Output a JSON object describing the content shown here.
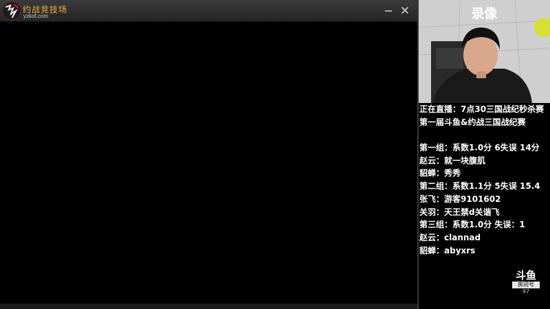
{
  "window": {
    "title": "约战竞技场",
    "domain": "yzkof.com",
    "minimize_symbol": "—",
    "close_symbol": "✕"
  },
  "camera": {
    "label": "录像"
  },
  "overlay_lines": [
    "正在直播：7点30三国战纪秒杀赛",
    "第一届斗鱼&约战三国战纪赛",
    "",
    "第一组：系数1.0分 6失误 14分",
    "赵云：就一块腹肌",
    "貂蝉：秀秀",
    "第二组：系数1.1分 5失误 15.4",
    "张飞：游客9101602",
    "关羽：天王禁d关谐飞",
    "第三组：系数1.0分 失误：1",
    "赵云：clannad",
    "貂蝉：abyxrs"
  ],
  "watermark": {
    "logo": "斗鱼",
    "sub": "房间号",
    "room_number": "97"
  }
}
